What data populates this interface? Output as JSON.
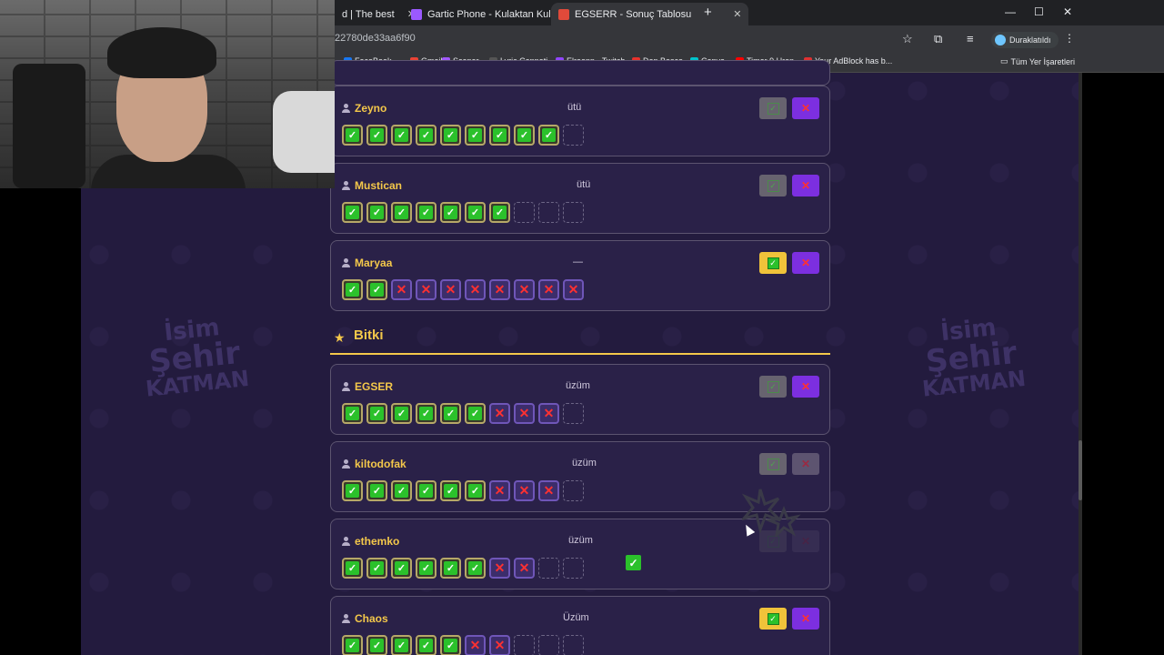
{
  "browser": {
    "tabs": [
      {
        "label": "d | The best",
        "color": "#5f6368",
        "active": false
      },
      {
        "label": "Gartic Phone - Kulaktan Kulağa",
        "color": "#9b59ff",
        "active": false
      },
      {
        "label": "EGSERR - Sonuç Tablosu",
        "color": "#e04a3a",
        "active": true
      }
    ],
    "new_tab": "+",
    "url_partial": "22780de33aa6f90",
    "profile_label": "Duraklatıldı",
    "bookmarks": [
      {
        "label": "FaceBook",
        "color": "#1877f2"
      },
      {
        "label": "Gmail",
        "color": "#ea4335"
      },
      {
        "label": "Scener",
        "color": "#a259ff"
      },
      {
        "label": "Lyric Cenneti",
        "color": "#555555"
      },
      {
        "label": "Elraenn - Twitch",
        "color": "#9146ff"
      },
      {
        "label": "Don Bosco",
        "color": "#e8322c"
      },
      {
        "label": "Canva",
        "color": "#00c4cc"
      },
      {
        "label": "Timer 9 Uren",
        "color": "#ff0000"
      },
      {
        "label": "Your AdBlock has b...",
        "color": "#e03131"
      }
    ],
    "all_bookmarks": "Tüm Yer İşaretleri"
  },
  "background_logo": {
    "line1": "İsim",
    "line2": "Şehir",
    "line3": "KATMAN"
  },
  "section": {
    "star": "★",
    "title": "Bitki"
  },
  "rows_above": [
    {
      "name": "Zeyno",
      "answer": "ütü",
      "marks": [
        "ok",
        "ok",
        "ok",
        "ok",
        "ok",
        "ok",
        "ok",
        "ok",
        "ok",
        "empty"
      ],
      "approved": false,
      "rejected": true
    },
    {
      "name": "Mustican",
      "answer": "ütü",
      "marks": [
        "ok",
        "ok",
        "ok",
        "ok",
        "ok",
        "ok",
        "ok",
        "empty",
        "empty",
        "empty"
      ],
      "approved": false,
      "rejected": true
    },
    {
      "name": "Maryaa",
      "answer": "—",
      "marks": [
        "ok",
        "ok",
        "no",
        "no",
        "no",
        "no",
        "no",
        "no",
        "no",
        "no"
      ],
      "approved": true,
      "rejected": true
    }
  ],
  "rows_below": [
    {
      "name": "EGSER",
      "answer": "üzüm",
      "marks": [
        "ok",
        "ok",
        "ok",
        "ok",
        "ok",
        "ok",
        "no",
        "no",
        "no",
        "empty"
      ],
      "approved": false,
      "rejected": true
    },
    {
      "name": "kiltodofak",
      "answer": "üzüm",
      "marks": [
        "ok",
        "ok",
        "ok",
        "ok",
        "ok",
        "ok",
        "no",
        "no",
        "no",
        "empty"
      ],
      "approved": false,
      "rejected": false
    },
    {
      "name": "ethemko",
      "answer": "üzüm",
      "marks": [
        "ok",
        "ok",
        "ok",
        "ok",
        "ok",
        "ok",
        "no",
        "no",
        "empty",
        "empty"
      ],
      "approved": false,
      "rejected": false,
      "faded": true
    },
    {
      "name": "Chaos",
      "answer": "Üzüm",
      "marks": [
        "ok",
        "ok",
        "ok",
        "ok",
        "ok",
        "no",
        "no",
        "empty",
        "empty",
        "empty"
      ],
      "approved": true,
      "rejected": true
    }
  ],
  "glyphs": {
    "check": "✓",
    "cross": "✕"
  }
}
